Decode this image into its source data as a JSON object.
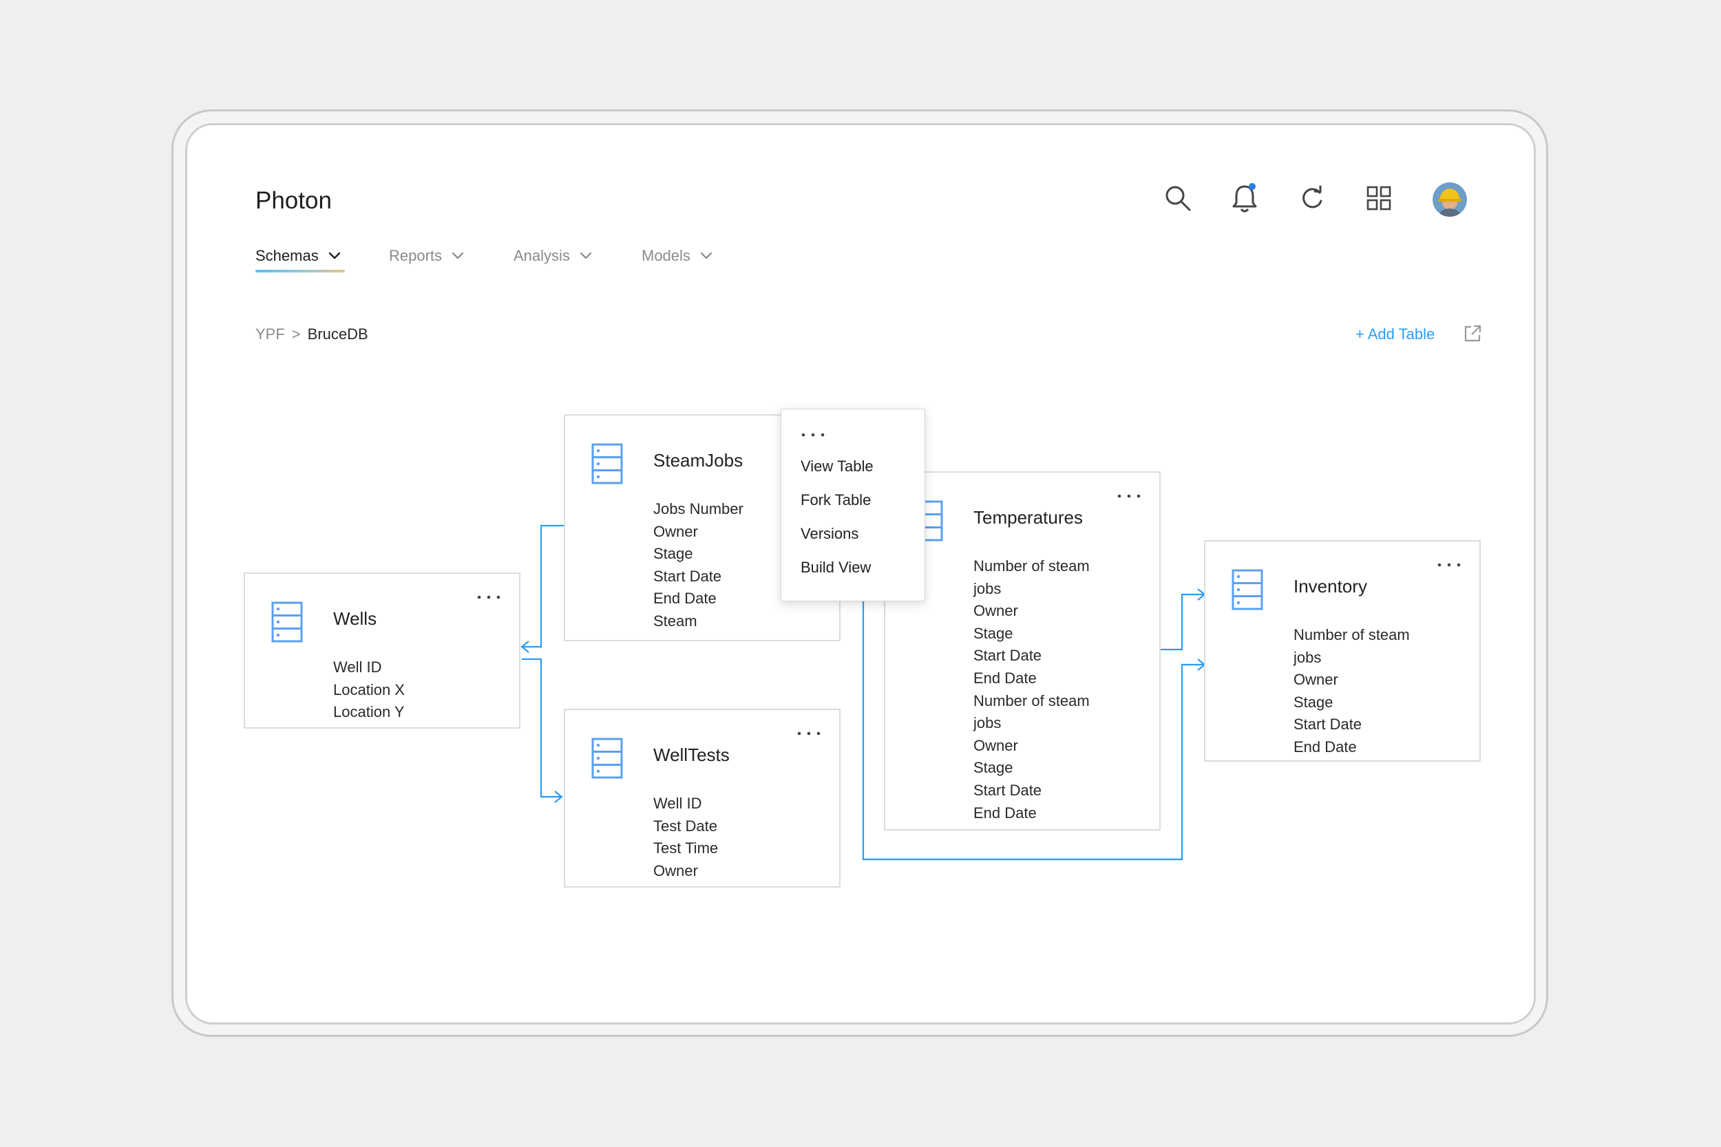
{
  "app": {
    "title": "Photon"
  },
  "nav": {
    "items": [
      {
        "label": "Schemas"
      },
      {
        "label": "Reports"
      },
      {
        "label": "Analysis"
      },
      {
        "label": "Models"
      }
    ]
  },
  "breadcrumb": {
    "root": "YPF",
    "sep": ">",
    "current": "BruceDB"
  },
  "actions": {
    "add_table": "+ Add Table"
  },
  "tables": {
    "wells": {
      "title": "Wells",
      "fields": [
        "Well ID",
        "Location X",
        "Location Y"
      ]
    },
    "steamjobs": {
      "title": "SteamJobs",
      "fields": [
        "Jobs Number",
        "Owner",
        "Stage",
        "Start Date",
        "End Date",
        "Steam"
      ]
    },
    "welltests": {
      "title": "WellTests",
      "fields": [
        "Well ID",
        "Test Date",
        "Test Time",
        "Owner"
      ]
    },
    "temperatures": {
      "title": "Temperatures",
      "fields": [
        "Number of steam",
        "jobs",
        "Owner",
        "Stage",
        "Start Date",
        "End Date",
        "Number of steam",
        "jobs",
        "Owner",
        "Stage",
        "Start Date",
        "End Date"
      ]
    },
    "inventory": {
      "title": "Inventory",
      "fields": [
        "Number of steam",
        "jobs",
        "Owner",
        "Stage",
        "Start Date",
        "End Date"
      ]
    }
  },
  "context_menu": {
    "items": [
      "View Table",
      "Fork Table",
      "Versions",
      "Build View"
    ]
  },
  "icons": {
    "top": [
      "search-icon",
      "bell-icon",
      "refresh-icon",
      "grid-icon"
    ],
    "table": "database-icon",
    "more": "more-dots-icon",
    "external": "external-link-icon"
  },
  "colors": {
    "accent": "#2a9df4",
    "db_icon": "#5aa0f0",
    "notification_dot": "#2a7de1"
  }
}
